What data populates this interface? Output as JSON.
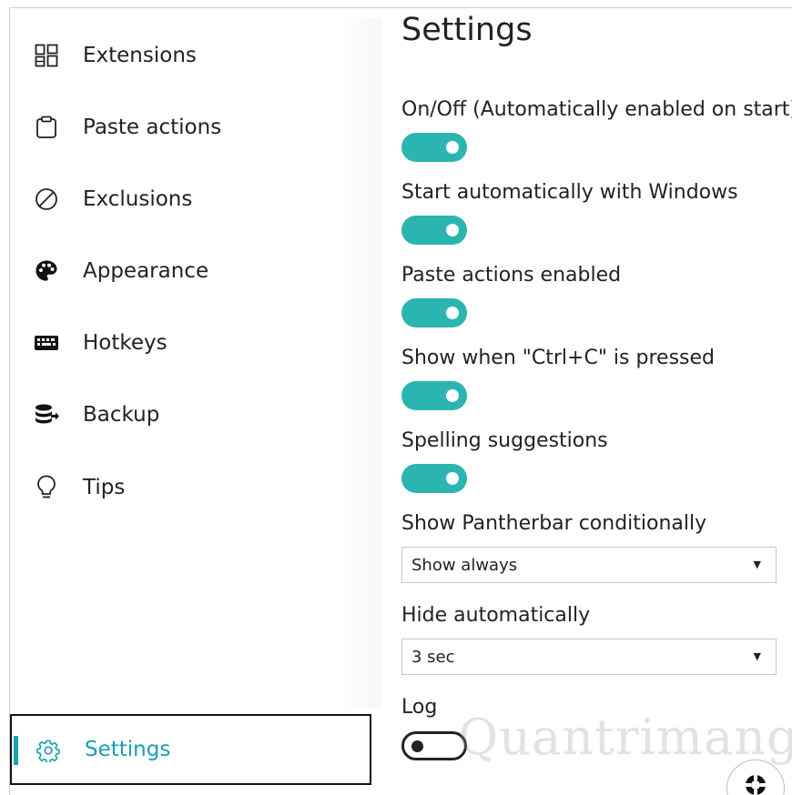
{
  "sidebar": {
    "items": [
      {
        "label": "Extensions",
        "icon": "extensions-icon"
      },
      {
        "label": "Paste actions",
        "icon": "clipboard-icon"
      },
      {
        "label": "Exclusions",
        "icon": "block-icon"
      },
      {
        "label": "Appearance",
        "icon": "palette-icon"
      },
      {
        "label": "Hotkeys",
        "icon": "keyboard-icon"
      },
      {
        "label": "Backup",
        "icon": "database-icon"
      },
      {
        "label": "Tips",
        "icon": "lightbulb-icon"
      }
    ],
    "active": {
      "label": "Settings",
      "icon": "gear-icon"
    }
  },
  "main": {
    "title": "Settings",
    "toggles": [
      {
        "label": "On/Off (Automatically enabled on start)",
        "on": true
      },
      {
        "label": "Start automatically with Windows",
        "on": true
      },
      {
        "label": "Paste actions enabled",
        "on": true
      },
      {
        "label": "Show when \"Ctrl+C\" is pressed",
        "on": true
      },
      {
        "label": "Spelling suggestions",
        "on": true
      }
    ],
    "dropdowns": [
      {
        "label": "Show Pantherbar conditionally",
        "value": "Show always"
      },
      {
        "label": "Hide automatically",
        "value": "3 sec"
      }
    ],
    "log": {
      "label": "Log",
      "on": false
    },
    "watermark": "Quantrimang"
  },
  "colors": {
    "accent": "#2bb5b0",
    "active_text": "#1a9fb0",
    "text": "#222222"
  }
}
